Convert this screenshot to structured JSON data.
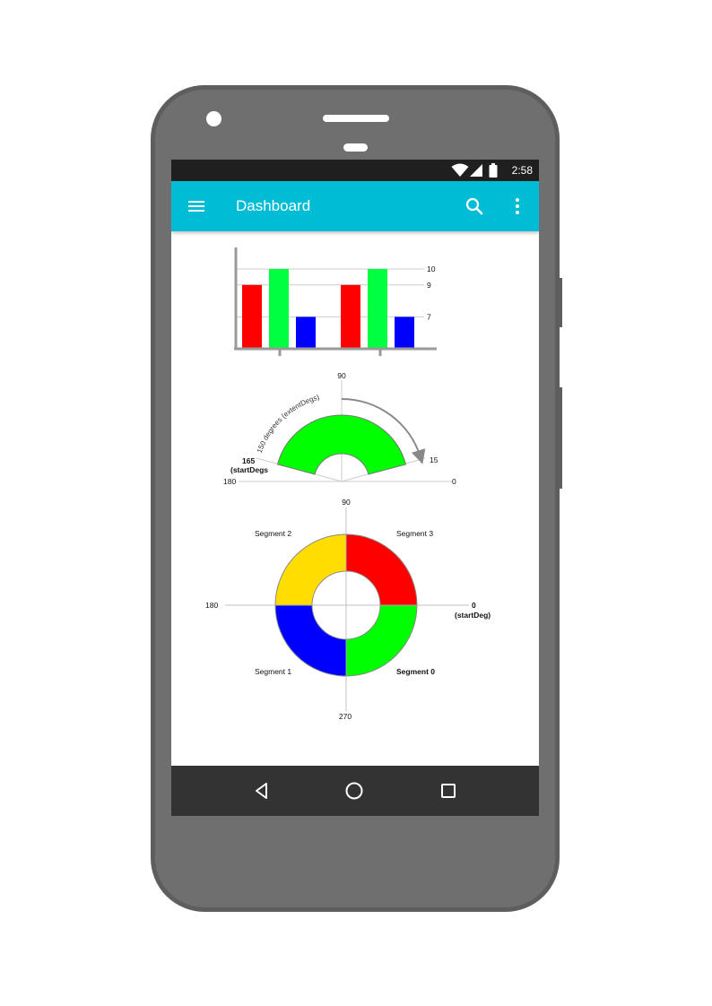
{
  "status_bar": {
    "time": "2:58",
    "icons": [
      "wifi-icon",
      "cell-signal-icon",
      "battery-icon"
    ]
  },
  "app_bar": {
    "title": "Dashboard",
    "icons": [
      "menu-icon",
      "search-icon",
      "more-vert-icon"
    ],
    "color": "#00bcd4"
  },
  "nav_bar": {
    "icons": [
      "back-icon",
      "home-icon",
      "recents-icon"
    ]
  },
  "chart_data": [
    {
      "type": "bar",
      "categories": [
        "",
        ""
      ],
      "series": [
        {
          "values": [
            9,
            9
          ],
          "color": "#ff0000"
        },
        {
          "values": [
            10,
            10
          ],
          "color": "#00ff40"
        },
        {
          "values": [
            7,
            7
          ],
          "color": "#0000ff"
        }
      ],
      "yticks": [
        "7",
        "9",
        "10"
      ],
      "ylim": [
        5,
        10
      ],
      "grid": true
    },
    {
      "type": "pie",
      "subtype": "arc-gauge",
      "arc_color": "#00ff00",
      "start_deg": 15,
      "end_deg": 165,
      "annotations": {
        "top": "90",
        "right_end": "15",
        "left_end_value": "165",
        "left_end_label": "(startDegs",
        "axis_left": "180",
        "axis_right": "0",
        "arc_label": "150 degrees (extentDegs)"
      }
    },
    {
      "type": "pie",
      "subtype": "donut",
      "segments": [
        {
          "label": "Segment 0",
          "start_deg": 270,
          "end_deg": 360,
          "color": "#00ff00"
        },
        {
          "label": "Segment 1",
          "start_deg": 180,
          "end_deg": 270,
          "color": "#0000ff"
        },
        {
          "label": "Segment 2",
          "start_deg": 90,
          "end_deg": 180,
          "color": "#ffdd00"
        },
        {
          "label": "Segment 3",
          "start_deg": 0,
          "end_deg": 90,
          "color": "#ff0000"
        }
      ],
      "axis_labels": {
        "top": "90",
        "left": "180",
        "bottom": "270",
        "right_value": "0",
        "right_label": "(startDeg)"
      }
    }
  ]
}
